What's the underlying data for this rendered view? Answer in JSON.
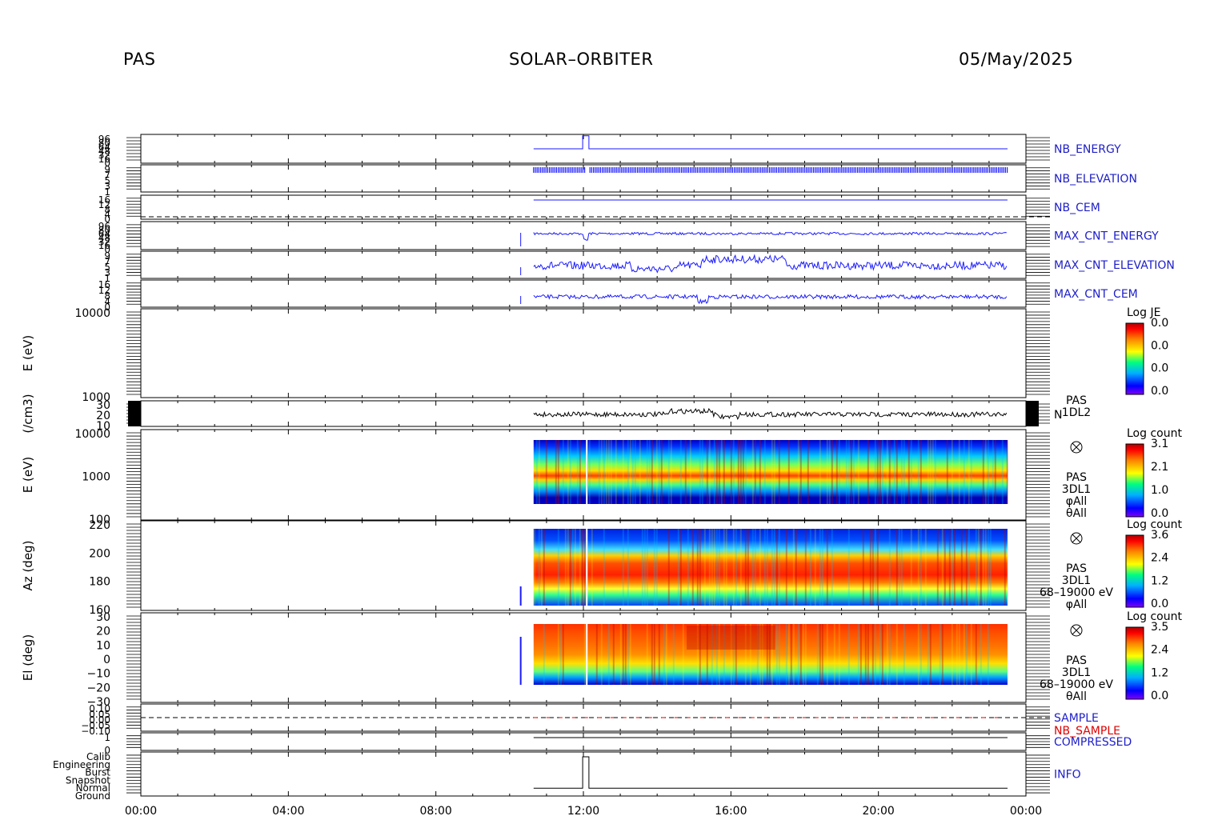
{
  "header": {
    "left": "PAS",
    "center": "SOLAR–ORBITER",
    "right": "05/May/2025"
  },
  "colors": {
    "trace_blue": "#1a1aff",
    "trace_black": "#000000",
    "label_blue": "#1e1ec8",
    "label_red": "#e00000",
    "colormap": [
      "#7f00ff",
      "#0000ff",
      "#00b0ff",
      "#00ff80",
      "#ffff00",
      "#ff8000",
      "#ff0000",
      "#b00000"
    ]
  },
  "chart_data": {
    "type": "line",
    "title": "SOLAR–ORBITER",
    "x_axis": {
      "ticks": [
        "00:00",
        "04:00",
        "08:00",
        "12:00",
        "16:00",
        "20:00",
        "00:00"
      ],
      "range_hours": [
        0,
        24
      ],
      "data_start_hour": 10.65,
      "data_end_hour": 23.5,
      "early_marker_hour": 10.3
    },
    "panels": [
      {
        "id": "nb_energy",
        "right_label": "NB_ENERGY",
        "label_color": "blue",
        "left_ticks": [
          "96",
          "80",
          "64",
          "48",
          "32",
          "16",
          "0"
        ],
        "series": [
          {
            "name": "NB_ENERGY",
            "values": [
              [
                10.65,
                0.5
              ],
              [
                11.98,
                0.5
              ],
              [
                11.98,
                0.95
              ],
              [
                12.15,
                0.95
              ],
              [
                12.15,
                0.5
              ],
              [
                23.5,
                0.5
              ]
            ]
          }
        ]
      },
      {
        "id": "nb_elevation",
        "right_label": "NB_ELEVATION",
        "label_color": "blue",
        "left_ticks": [
          "9",
          "7",
          "5",
          "3",
          "1"
        ],
        "series": [
          {
            "name": "NB_ELEVATION"
          }
        ]
      },
      {
        "id": "nb_cem",
        "right_label": "NB_CEM",
        "label_color": "blue",
        "left_ticks": [
          "16",
          "12",
          "8",
          "4",
          "0"
        ],
        "series": [
          {
            "name": "NB_CEM"
          }
        ]
      },
      {
        "id": "max_cnt_energy",
        "right_label": "MAX_CNT_ENERGY",
        "label_color": "blue",
        "left_ticks": [
          "96",
          "80",
          "64",
          "48",
          "32",
          "16",
          "0"
        ],
        "series": [
          {
            "name": "MAX_CNT_ENERGY"
          }
        ]
      },
      {
        "id": "max_cnt_elevation",
        "right_label": "MAX_CNT_ELEVATION",
        "label_color": "blue",
        "left_ticks": [
          "9",
          "7",
          "5",
          "3",
          "1"
        ],
        "series": [
          {
            "name": "MAX_CNT_ELEVATION"
          }
        ]
      },
      {
        "id": "max_cnt_cem",
        "right_label": "MAX_CNT_CEM",
        "label_color": "blue",
        "left_ticks": [
          "16",
          "12",
          "8",
          "4",
          "0"
        ],
        "series": [
          {
            "name": "MAX_CNT_CEM"
          }
        ]
      },
      {
        "id": "pas_1dl2_energy",
        "ylabel": "E (eV)",
        "ylim": [
          0,
          0
        ],
        "yticks": [
          "10000",
          "1000"
        ],
        "colorbar": {
          "label": "Log JE",
          "ticks": [
            "0.0",
            "0.0",
            "0.0",
            "0.0"
          ]
        }
      },
      {
        "id": "density",
        "ylabel": "(/cm3)",
        "yticks": [
          "30",
          "20",
          "10"
        ],
        "right_label": "N",
        "annotation": [
          "PAS",
          "1DL2"
        ],
        "series": [
          {
            "name": "N"
          }
        ]
      },
      {
        "id": "pas_3dl1_energy",
        "ylabel": "E (eV)",
        "yticks": [
          "10000",
          "1000",
          "100"
        ],
        "annotation": [
          "PAS",
          "3DL1",
          "φAll",
          "θAll"
        ],
        "colorbar": {
          "label": "Log count",
          "ticks": [
            "3.1",
            "2.1",
            "1.0",
            "0.0"
          ]
        }
      },
      {
        "id": "pas_3dl1_azimuth",
        "ylabel": "Az (deg)",
        "yticks": [
          "220",
          "200",
          "180",
          "160"
        ],
        "annotation": [
          "PAS",
          "3DL1",
          "68–19000 eV",
          "φAll"
        ],
        "colorbar": {
          "label": "Log count",
          "ticks": [
            "3.6",
            "2.4",
            "1.2",
            "0.0"
          ]
        }
      },
      {
        "id": "pas_3dl1_elevation",
        "ylabel": "El (deg)",
        "yticks": [
          "30",
          "20",
          "10",
          "0",
          "−10",
          "−20",
          "−30"
        ],
        "annotation": [
          "PAS",
          "3DL1",
          "68–19000 eV",
          "θAll"
        ],
        "colorbar": {
          "label": "Log count",
          "ticks": [
            "3.5",
            "2.4",
            "1.2",
            "0.0"
          ]
        }
      },
      {
        "id": "sample",
        "right_label": "SAMPLE",
        "right_label2": "NB_SAMPLE",
        "left_ticks": [
          "0.10",
          "0.05",
          "0.00",
          "−0.05",
          "−0.10"
        ]
      },
      {
        "id": "compressed",
        "right_label": "COMPRESSED",
        "left_ticks": [
          "1",
          "0"
        ]
      },
      {
        "id": "info",
        "right_label": "INFO",
        "left_ticks": [
          "Calib",
          "Engineering",
          "Burst",
          "Snapshot",
          "Normal",
          "Ground"
        ],
        "series": [
          {
            "name": "INFO",
            "values": [
              [
                10.65,
                "Normal"
              ],
              [
                11.98,
                "Normal"
              ],
              [
                11.98,
                "Calib"
              ],
              [
                12.15,
                "Calib"
              ],
              [
                12.15,
                "Normal"
              ],
              [
                23.5,
                "Normal"
              ]
            ]
          }
        ]
      }
    ]
  }
}
